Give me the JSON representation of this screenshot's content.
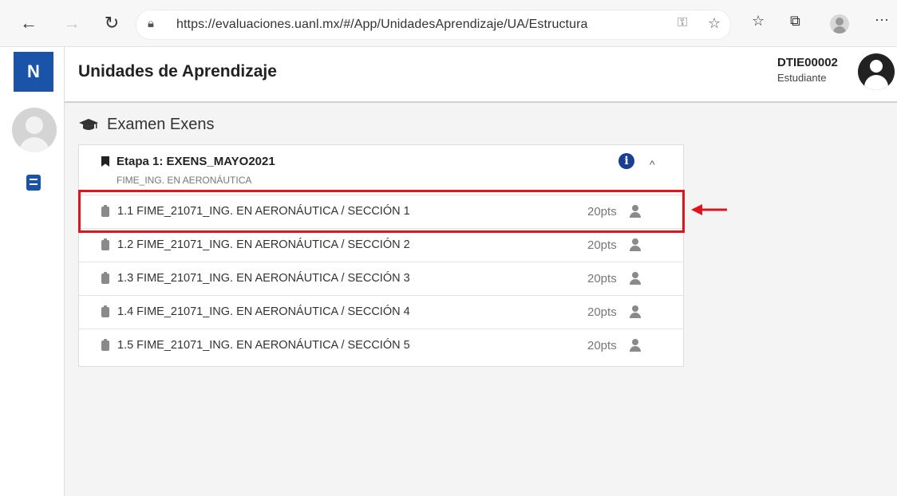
{
  "browser": {
    "url": "https://evaluaciones.uanl.mx/#/App/UnidadesAprendizaje/UA/Estructura",
    "more_label": "···"
  },
  "sidebar": {
    "logo_text": "N"
  },
  "header": {
    "title": "Unidades de Aprendizaje",
    "user_code": "DTIE00002",
    "user_role": "Estudiante"
  },
  "main": {
    "section_title": "Examen Exens",
    "stage": {
      "title": "Etapa 1: EXENS_MAYO2021",
      "subtitle": "FIME_ING. EN AERONÁUTICA",
      "info_label": "i",
      "collapse_label": "^"
    },
    "items": [
      {
        "label": "1.1 FIME_21071_ING. EN AERONÁUTICA / SECCIÓN 1",
        "points": "20pts"
      },
      {
        "label": "1.2 FIME_21071_ING. EN AERONÁUTICA / SECCIÓN 2",
        "points": "20pts"
      },
      {
        "label": "1.3 FIME_21071_ING. EN AERONÁUTICA / SECCIÓN 3",
        "points": "20pts"
      },
      {
        "label": "1.4 FIME_21071_ING. EN AERONÁUTICA / SECCIÓN 4",
        "points": "20pts"
      },
      {
        "label": "1.5 FIME_21071_ING. EN AERONÁUTICA / SECCIÓN 5",
        "points": "20pts"
      }
    ]
  },
  "colors": {
    "brand": "#1a54a8",
    "highlight": "#e0141b"
  }
}
